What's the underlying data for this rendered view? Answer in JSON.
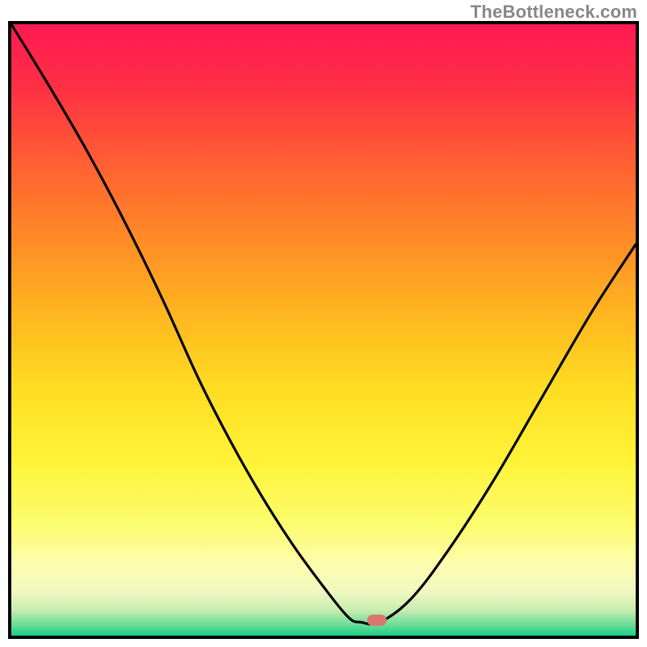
{
  "watermark": {
    "text": "TheBottleneck.com"
  },
  "frame": {
    "inner_width": 772,
    "inner_height": 756,
    "gradient_stops": [
      {
        "offset": 0.0,
        "color": "#ff1a52"
      },
      {
        "offset": 0.1,
        "color": "#ff2e45"
      },
      {
        "offset": 0.22,
        "color": "#ff5d33"
      },
      {
        "offset": 0.35,
        "color": "#ff8a26"
      },
      {
        "offset": 0.48,
        "color": "#ffb81f"
      },
      {
        "offset": 0.6,
        "color": "#ffde22"
      },
      {
        "offset": 0.72,
        "color": "#fff43a"
      },
      {
        "offset": 0.82,
        "color": "#fcfc70"
      },
      {
        "offset": 0.885,
        "color": "#fdfdb0"
      },
      {
        "offset": 0.928,
        "color": "#f0f8c0"
      },
      {
        "offset": 0.958,
        "color": "#c8edb0"
      },
      {
        "offset": 0.982,
        "color": "#6bdc9a"
      },
      {
        "offset": 1.0,
        "color": "#18cf84"
      }
    ]
  },
  "marker": {
    "x_frac": 0.586,
    "y_frac": 0.9755,
    "color": "#d9776e"
  },
  "chart_data": {
    "type": "line",
    "title": "",
    "xlabel": "",
    "ylabel": "",
    "xlim": [
      0,
      1
    ],
    "ylim": [
      0,
      1
    ],
    "note": "Bottleneck-style V-curve. x is normalized horizontal position; y is normalized value where 0=bottom, 1=top. Flat near-zero segment around x≈0.55–0.59 is the minimum; red marker sits at x≈0.586.",
    "series": [
      {
        "name": "curve",
        "x": [
          0.0,
          0.06,
          0.12,
          0.18,
          0.24,
          0.3,
          0.35,
          0.4,
          0.45,
          0.5,
          0.54,
          0.56,
          0.59,
          0.64,
          0.7,
          0.77,
          0.85,
          0.93,
          1.0
        ],
        "y": [
          1.0,
          0.9,
          0.795,
          0.68,
          0.555,
          0.42,
          0.32,
          0.23,
          0.15,
          0.08,
          0.03,
          0.022,
          0.022,
          0.06,
          0.14,
          0.25,
          0.39,
          0.53,
          0.64
        ]
      }
    ],
    "marker_point": {
      "x": 0.586,
      "y": 0.0245
    },
    "background": "vertical red→yellow→green gradient"
  }
}
